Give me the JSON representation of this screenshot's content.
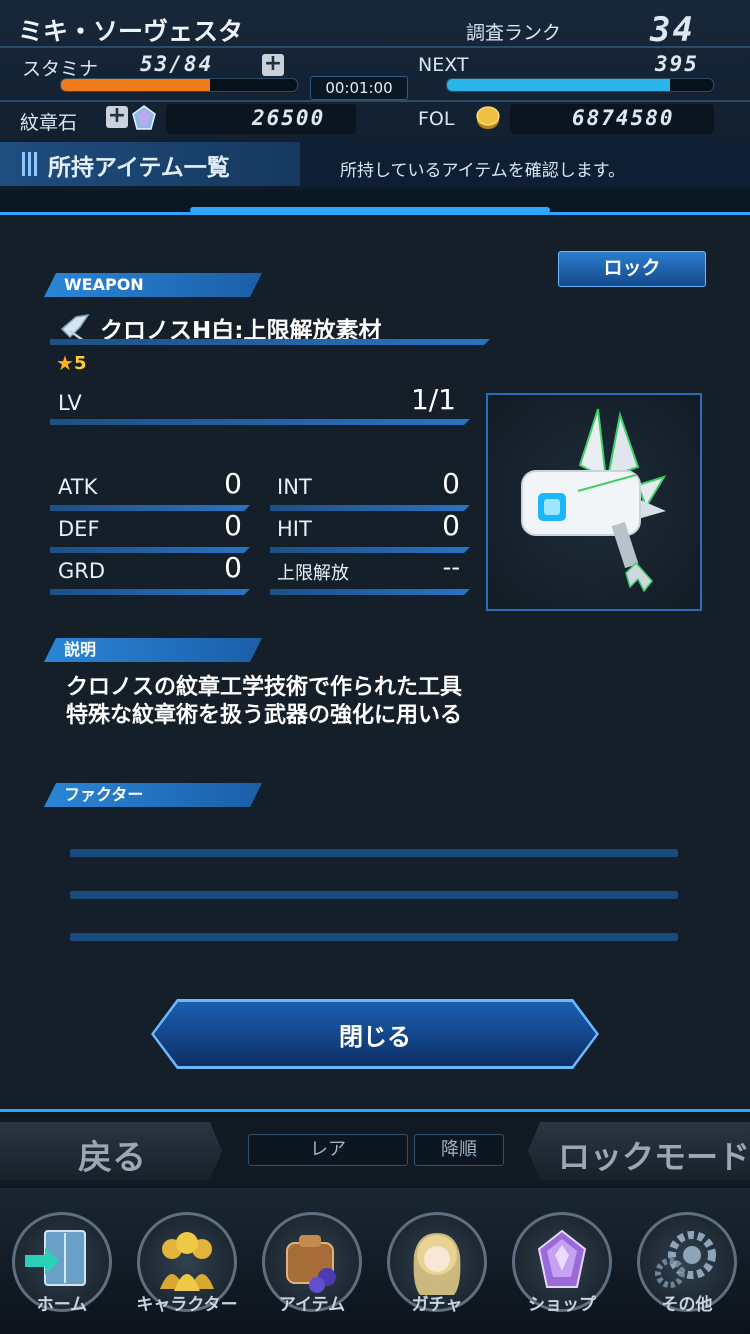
{
  "header": {
    "player_name": "ミキ・ソーヴェスタ",
    "rank_label": "調査ランク",
    "rank_value": "34",
    "stamina_label": "スタミナ",
    "stamina_value": "53/84",
    "stamina_fraction": 0.63,
    "stamina_timer": "00:01:00",
    "next_label": "NEXT",
    "next_value": "395",
    "next_fraction": 0.84,
    "crest_label": "紋章石",
    "crest_value": "26500",
    "fol_label": "FOL",
    "fol_value": "6874580",
    "screen_title": "所持アイテム一覧",
    "screen_subtitle": "所持しているアイテムを確認します。"
  },
  "item": {
    "category_label": "WEAPON",
    "name": "クロノスH白:上限解放素材",
    "rarity": "5",
    "lock_label": "ロック",
    "lv_label": "LV",
    "lv_value": "1/1",
    "stats": {
      "atk_label": "ATK",
      "atk_value": "0",
      "int_label": "INT",
      "int_value": "0",
      "def_label": "DEF",
      "def_value": "0",
      "hit_label": "HIT",
      "hit_value": "0",
      "grd_label": "GRD",
      "grd_value": "0",
      "limit_label": "上限解放",
      "limit_value": "--"
    },
    "description_label": "説明",
    "description_line1": "クロノスの紋章工学技術で作られた工具",
    "description_line2": "特殊な紋章術を扱う武器の強化に用いる",
    "factor_label": "ファクター",
    "close_label": "閉じる"
  },
  "bottom": {
    "back_label": "戻る",
    "sort_rarity": "レア",
    "sort_order": "降順",
    "lock_mode_label": "ロックモード"
  },
  "nav": [
    {
      "label": "ホーム",
      "icon": "home-door-icon"
    },
    {
      "label": "キャラクター",
      "icon": "characters-icon"
    },
    {
      "label": "アイテム",
      "icon": "item-bag-icon"
    },
    {
      "label": "ガチャ",
      "icon": "gacha-icon"
    },
    {
      "label": "ショップ",
      "icon": "shop-crystal-icon"
    },
    {
      "label": "その他",
      "icon": "settings-gear-icon"
    }
  ],
  "colors": {
    "accent": "#2ea6ff",
    "stamina_bar": "#f07a18",
    "next_bar": "#2bb4e8"
  }
}
